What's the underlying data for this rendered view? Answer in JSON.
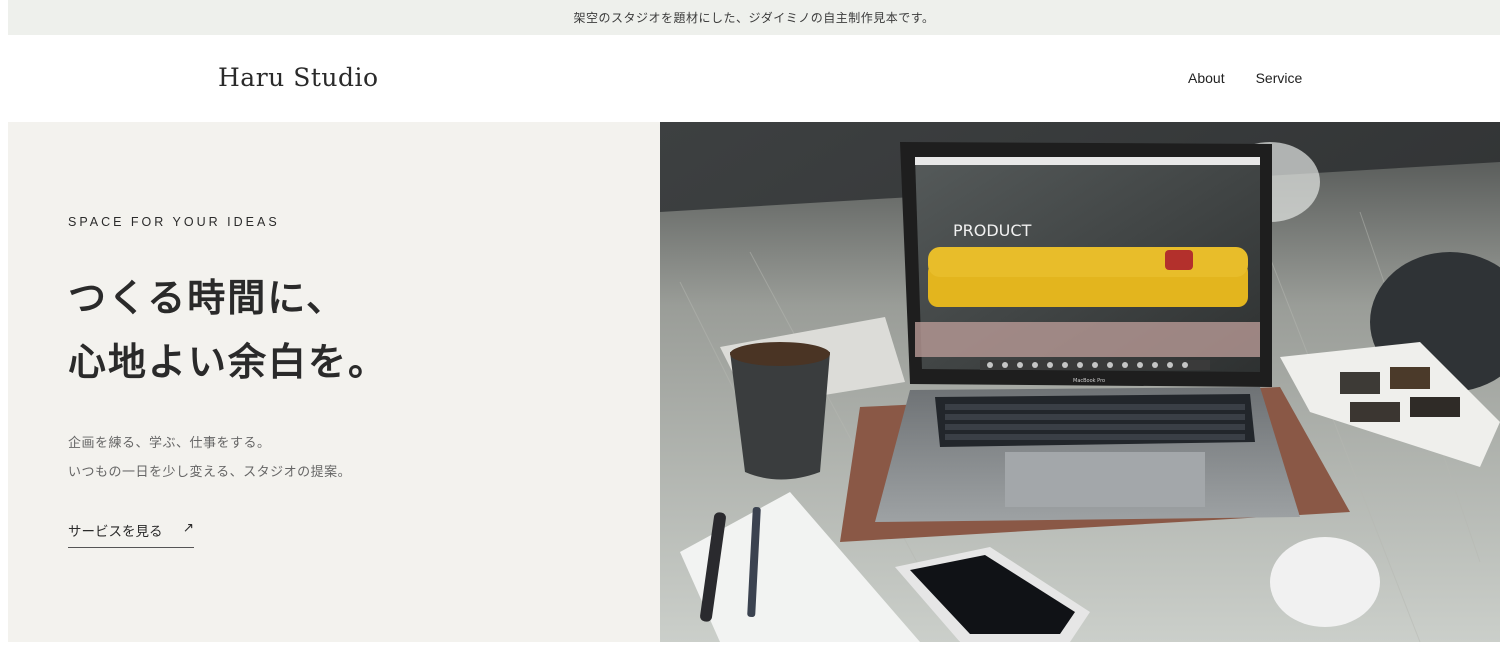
{
  "notice": {
    "text": "架空のスタジオを題材にした、ジダイミノの自主制作見本です。"
  },
  "header": {
    "logo": "Haru Studio",
    "nav": [
      {
        "label": "About"
      },
      {
        "label": "Service"
      }
    ]
  },
  "hero": {
    "eyebrow": "SPACE FOR YOUR IDEAS",
    "headline_line1": "つくる時間に、",
    "headline_line2": "心地よい余白を。",
    "sub_line1": "企画を練る、学ぶ、仕事をする。",
    "sub_line2": "いつもの一日を少し変える、スタジオの提案。",
    "cta_label": "サービスを見る",
    "cta_arrow": "↗",
    "image": {
      "screen_title": "PRODUCT",
      "laptop_label": "MacBook Pro"
    }
  }
}
